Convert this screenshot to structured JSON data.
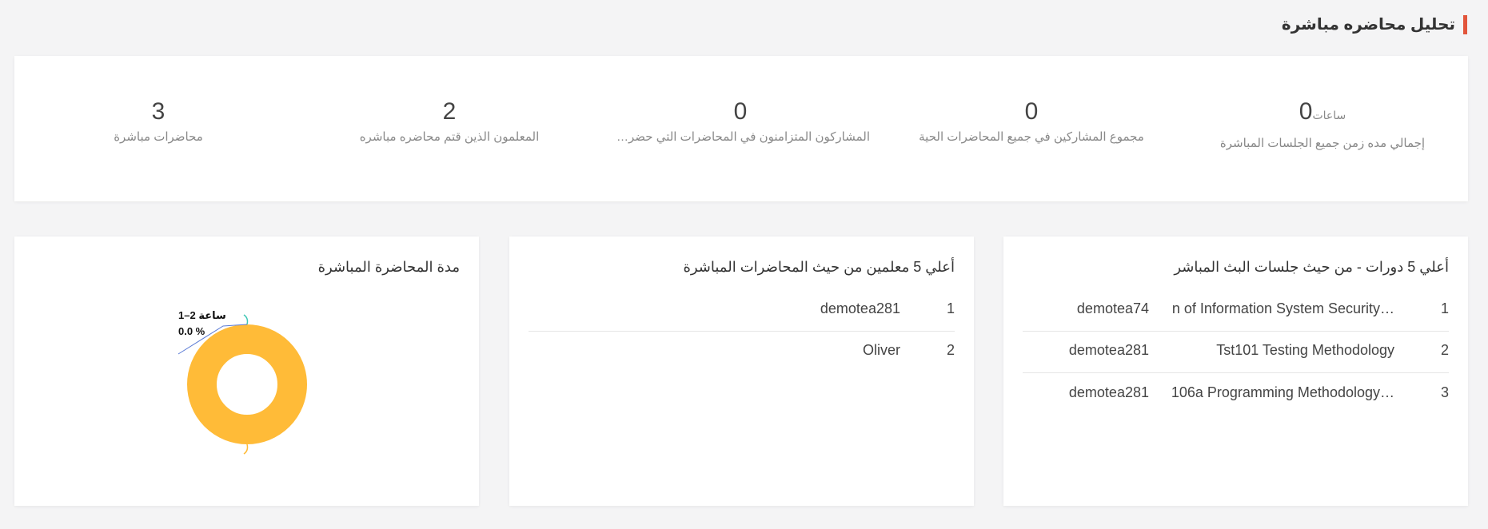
{
  "page": {
    "title": "تحليل محاضره مباشرة"
  },
  "stats": {
    "total_duration": {
      "value": "0",
      "unit": "ساعات",
      "label": "إجمالي مده زمن جميع الجلسات المباشرة"
    },
    "total_participants": {
      "value": "0",
      "label": "مجموع المشاركين في جميع المحاضرات الحية"
    },
    "concurrent_participants": {
      "value": "0",
      "label": "المشاركون المتزامنون في المحاضرات التي حضرها أ..."
    },
    "teachers_count": {
      "value": "2",
      "label": "المعلمون الذين قتم محاضره مباشره"
    },
    "live_lectures": {
      "value": "3",
      "label": "محاضرات مباشرة"
    }
  },
  "top_courses": {
    "title": "أعلي 5 دورات - من حيث جلسات البث المباشر",
    "rows": [
      {
        "rank": "1",
        "course": "…n of Information System Security",
        "teacher": "demotea74"
      },
      {
        "rank": "2",
        "course": "Tst101 Testing Methodology",
        "teacher": "demotea281"
      },
      {
        "rank": "3",
        "course": "…106a Programming Methodology",
        "teacher": "demotea281"
      }
    ]
  },
  "top_teachers": {
    "title": "أعلي 5 معلمين من حيث المحاضرات المباشرة",
    "rows": [
      {
        "rank": "1",
        "name": "demotea281"
      },
      {
        "rank": "2",
        "name": "Oliver"
      }
    ]
  },
  "duration_panel": {
    "title": "مدة المحاضرة المباشرة"
  },
  "chart_data": {
    "type": "pie",
    "variant": "donut",
    "labels": [
      "1–2 ساعة"
    ],
    "values": [
      0.0
    ],
    "percent_labels": [
      "0.0 %"
    ],
    "colors": {
      "main": "#ffbb38",
      "leader_line": "#5b7bd5",
      "accent": "#3fc7b5"
    }
  }
}
